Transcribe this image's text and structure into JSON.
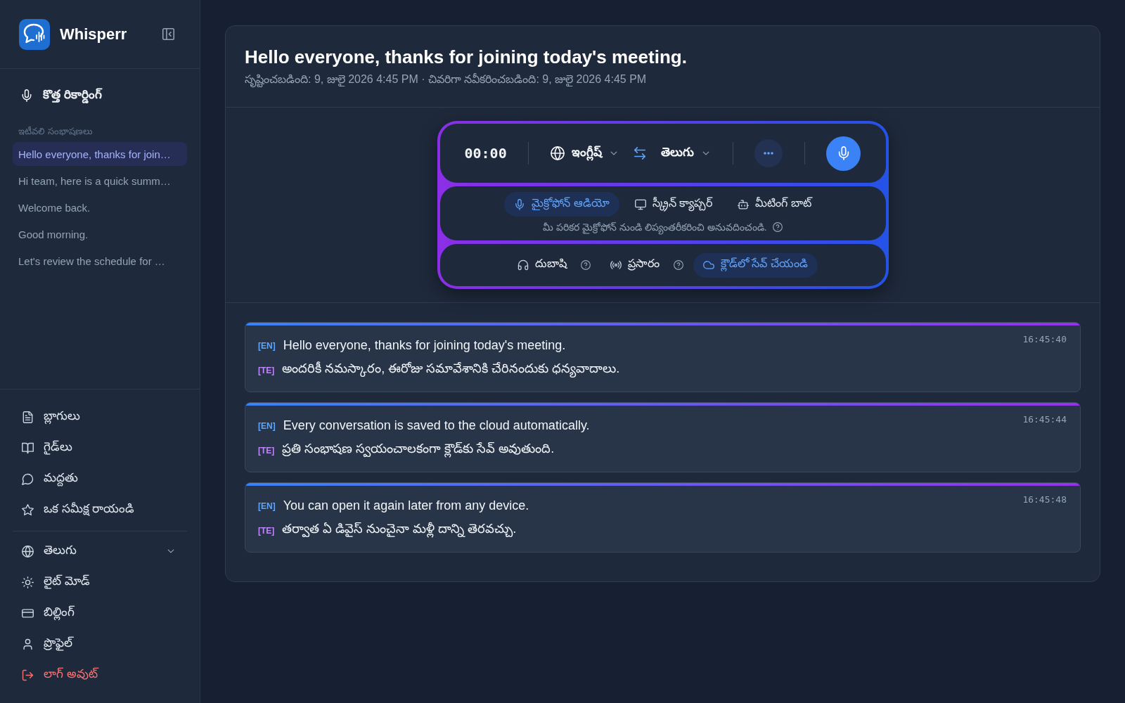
{
  "sidebar": {
    "brand": "Whisperr",
    "new_recording": "కొత్త రికార్డింగ్",
    "recent_heading": "ఇటీవలి సంభాషణలు",
    "recent": [
      {
        "title": "Hello everyone, thanks for join…",
        "selected": true
      },
      {
        "title": "Hi team, here is a quick summ…",
        "selected": false
      },
      {
        "title": "Welcome back.",
        "selected": false
      },
      {
        "title": "Good morning.",
        "selected": false
      },
      {
        "title": "Let's review the schedule for …",
        "selected": false
      }
    ],
    "links": [
      "బ్లాగులు",
      "గైడ్‌లు",
      "మద్దతు",
      "ఒక సమీక్ష రాయండి"
    ],
    "settings": [
      {
        "kind": "dropdown",
        "label": "తెలుగు"
      },
      {
        "kind": "link",
        "label": "లైట్ మోడ్"
      },
      {
        "kind": "link",
        "label": "బిల్లింగ్"
      },
      {
        "kind": "link",
        "label": "ప్రొఫైల్"
      },
      {
        "kind": "danger",
        "label": "లాగ్ అవుట్"
      }
    ]
  },
  "document": {
    "title": "Hello everyone, thanks for joining today's meeting.",
    "meta": "సృష్టించబడింది: 9, జులై 2026 4:45 PM · చివరిగా నవీకరించబడింది: 9, జులై 2026 4:45 PM"
  },
  "recorder": {
    "timer": "00:00",
    "source_language": "ఇంగ్లీష్",
    "target_language": "తెలుగు",
    "modes": [
      {
        "label": "మైక్రోఫోన్ ఆడియో",
        "selected": true
      },
      {
        "label": "స్క్రీన్ క్యాప్చర్",
        "selected": false
      },
      {
        "label": "మీటింగ్ బాట్",
        "selected": false
      }
    ],
    "mode_description": "మీ పరికర మైక్రోఫోన్ నుండి లిప్యంతరీకరించి అనువదించండి.",
    "options": [
      {
        "label": "దుబాషి",
        "on": false,
        "help": true
      },
      {
        "label": "ప్రసారం",
        "on": false,
        "help": true
      },
      {
        "label": "క్లౌడ్‌లో సేవ్ చేయండి",
        "on": true,
        "help": false
      }
    ]
  },
  "transcript": [
    {
      "time": "16:45:40",
      "lines": [
        {
          "tag": "[EN]",
          "color": "#60a5fa",
          "text": "Hello everyone, thanks for joining today's meeting."
        },
        {
          "tag": "[TE]",
          "color": "#c084fc",
          "text": "అందరికీ నమస్కారం, ఈరోజు సమావేశానికి చేరినందుకు ధన్యవాదాలు."
        }
      ]
    },
    {
      "time": "16:45:44",
      "lines": [
        {
          "tag": "[EN]",
          "color": "#60a5fa",
          "text": "Every conversation is saved to the cloud automatically."
        },
        {
          "tag": "[TE]",
          "color": "#c084fc",
          "text": "ప్రతి సంభాషణ స్వయంచాలకంగా క్లౌడ్‌కు సేవ్ అవుతుంది."
        }
      ]
    },
    {
      "time": "16:45:48",
      "lines": [
        {
          "tag": "[EN]",
          "color": "#60a5fa",
          "text": "You can open it again later from any device."
        },
        {
          "tag": "[TE]",
          "color": "#c084fc",
          "text": "తర్వాత ఏ డివైస్ నుంచైనా మళ్లీ దాన్ని తెరవచ్చు."
        }
      ]
    }
  ]
}
